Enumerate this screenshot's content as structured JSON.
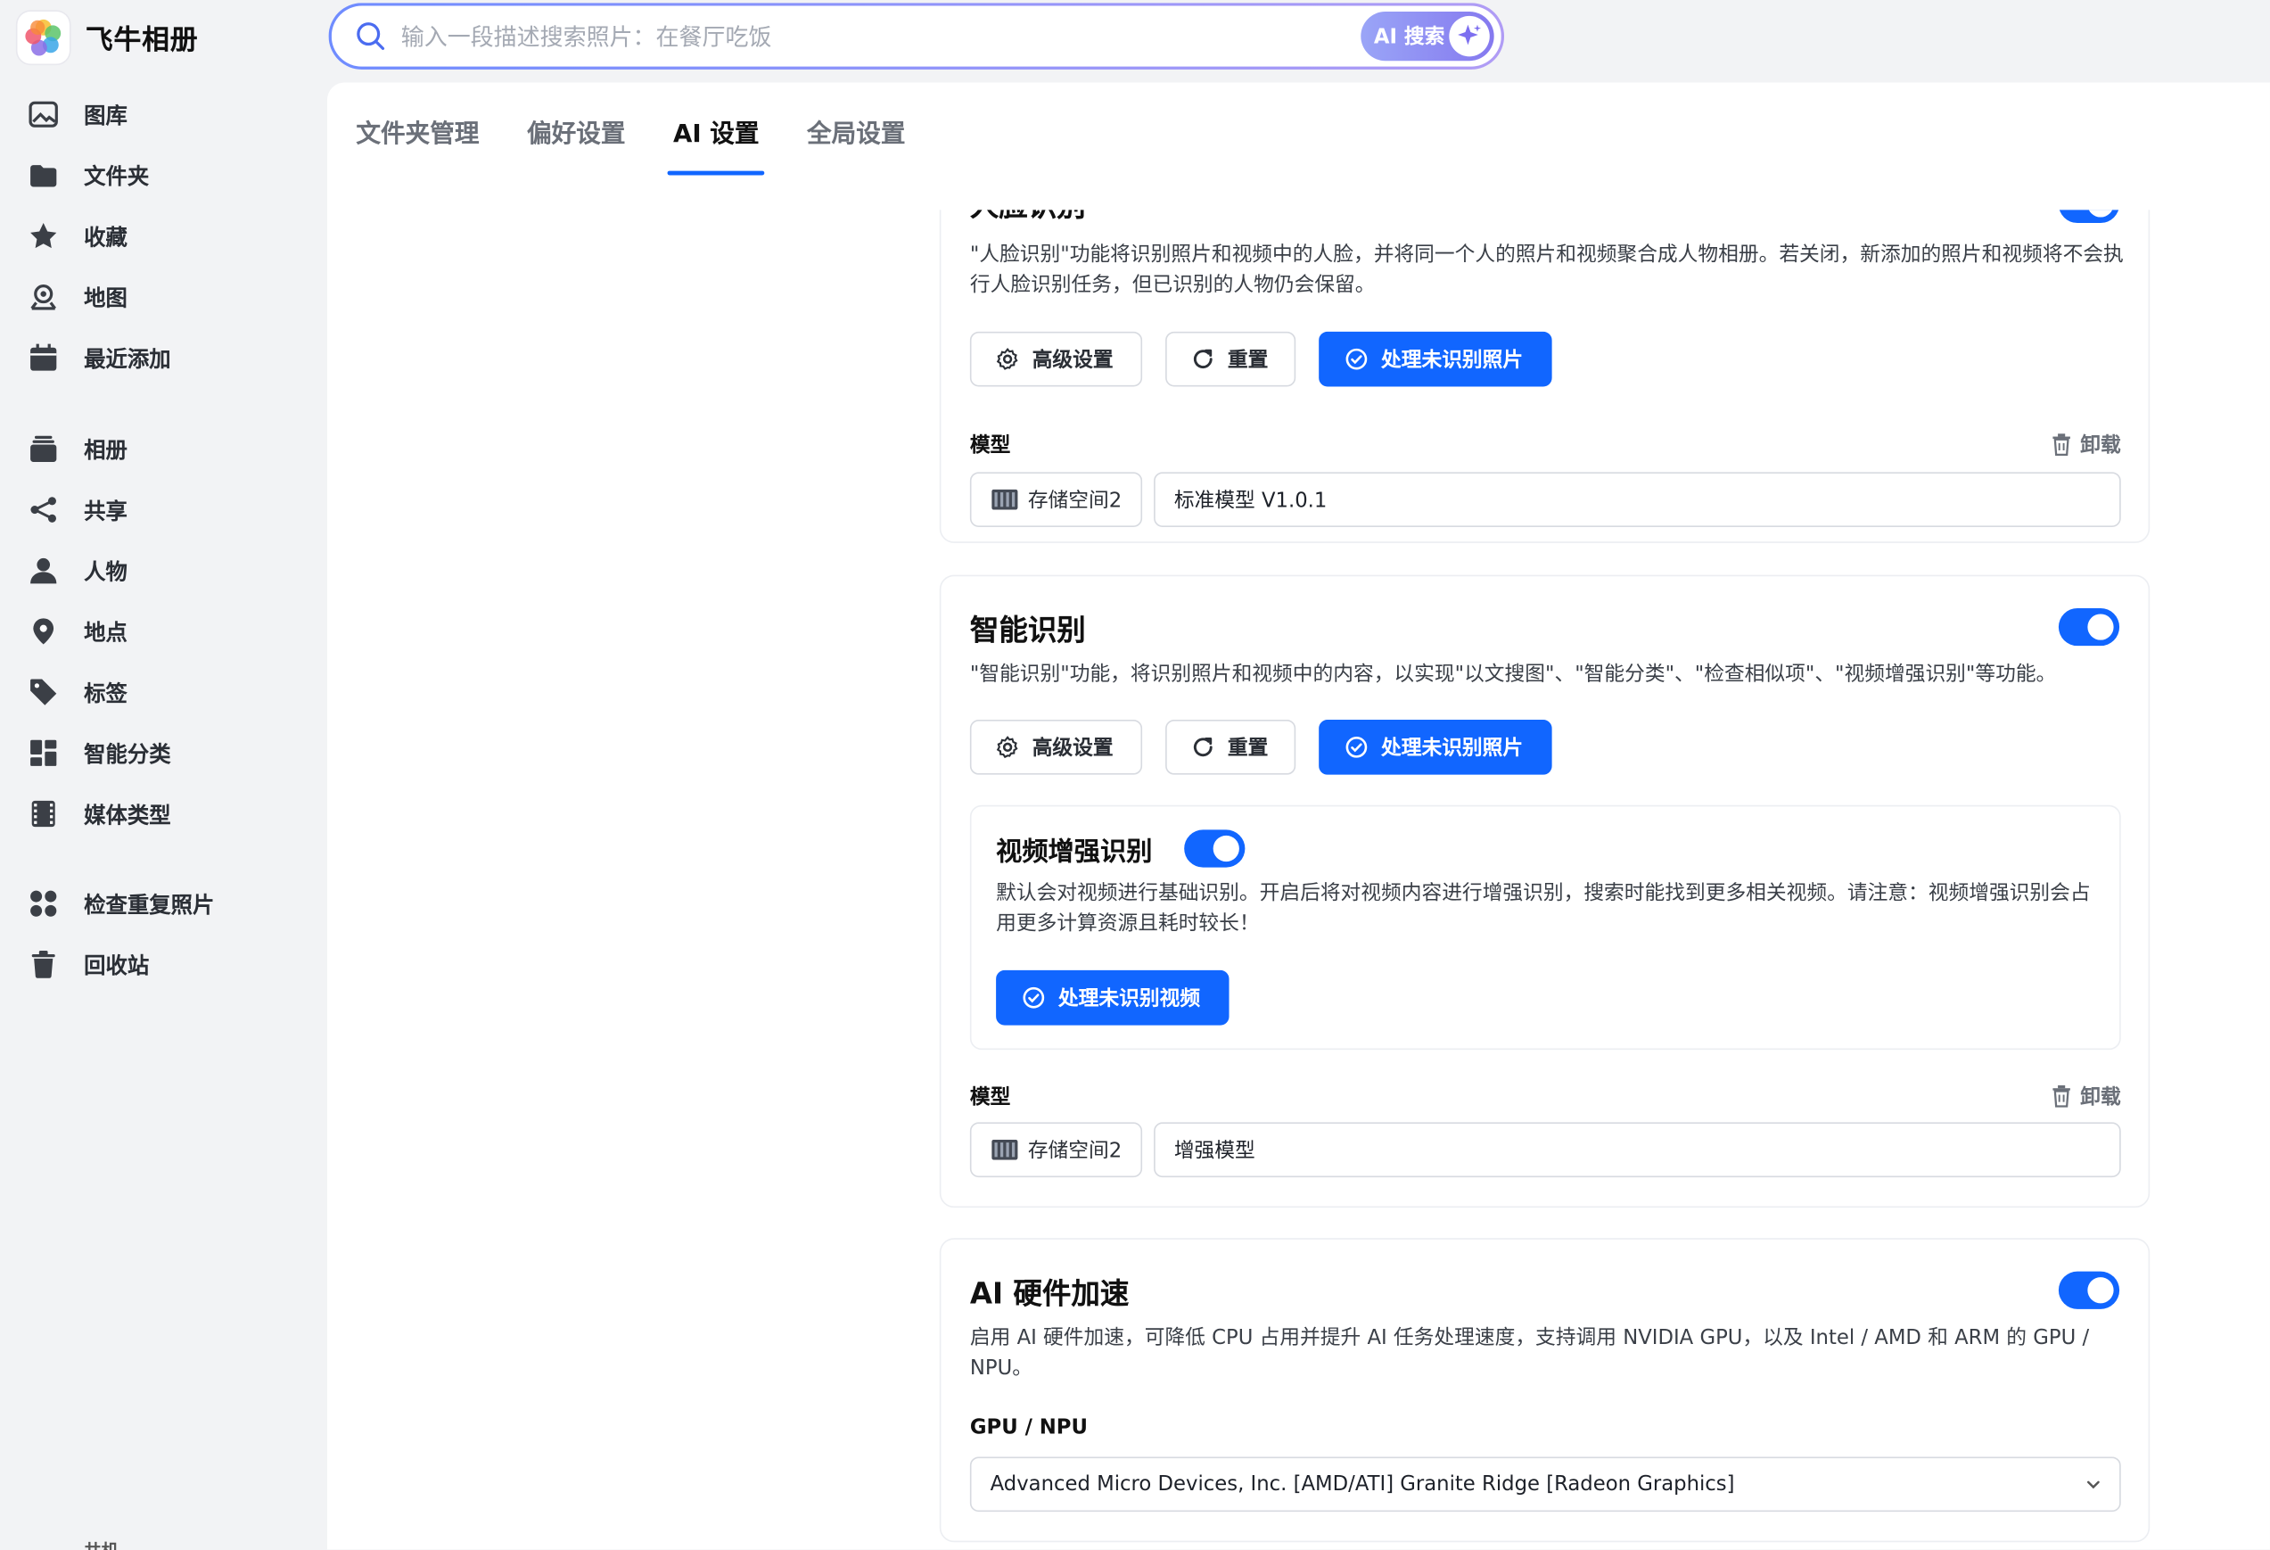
{
  "app": {
    "name": "飞牛相册"
  },
  "search": {
    "placeholder": "输入一段描述搜索照片：在餐厅吃饭",
    "ai_button": "AI 搜索"
  },
  "sidebar": {
    "items": [
      {
        "label": "图库",
        "icon": "gallery-icon"
      },
      {
        "label": "文件夹",
        "icon": "folder-icon"
      },
      {
        "label": "收藏",
        "icon": "star-icon"
      },
      {
        "label": "地图",
        "icon": "map-icon"
      },
      {
        "label": "最近添加",
        "icon": "calendar-icon"
      },
      {
        "label": "相册",
        "icon": "album-icon"
      },
      {
        "label": "共享",
        "icon": "share-icon"
      },
      {
        "label": "人物",
        "icon": "person-icon"
      },
      {
        "label": "地点",
        "icon": "location-icon"
      },
      {
        "label": "标签",
        "icon": "tag-icon"
      },
      {
        "label": "智能分类",
        "icon": "grid-icon"
      },
      {
        "label": "媒体类型",
        "icon": "film-icon"
      },
      {
        "label": "检查重复照片",
        "icon": "duplicate-icon"
      },
      {
        "label": "回收站",
        "icon": "trash-icon"
      }
    ],
    "cut_off_label": "共机"
  },
  "tabs": [
    {
      "label": "文件夹管理",
      "active": false
    },
    {
      "label": "偏好设置",
      "active": false
    },
    {
      "label": "AI 设置",
      "active": true
    },
    {
      "label": "全局设置",
      "active": false
    }
  ],
  "face_card": {
    "title": "人脸识别",
    "toggle_on": true,
    "description": "\"人脸识别\"功能将识别照片和视频中的人脸，并将同一个人的照片和视频聚合成人物相册。若关闭，新添加的照片和视频将不会执行人脸识别任务，但已识别的人物仍会保留。",
    "buttons": {
      "advanced": "高级设置",
      "reset": "重置",
      "process": "处理未识别照片"
    },
    "model_label": "模型",
    "uninstall": "卸载",
    "storage": "存储空间2",
    "model_value": "标准模型 V1.0.1"
  },
  "smart_card": {
    "title": "智能识别",
    "toggle_on": true,
    "description": "\"智能识别\"功能，将识别照片和视频中的内容，以实现\"以文搜图\"、\"智能分类\"、\"检查相似项\"、\"视频增强识别\"等功能。",
    "buttons": {
      "advanced": "高级设置",
      "reset": "重置",
      "process": "处理未识别照片"
    },
    "video": {
      "title": "视频增强识别",
      "toggle_on": true,
      "description": "默认会对视频进行基础识别。开启后将对视频内容进行增强识别，搜索时能找到更多相关视频。请注意：视频增强识别会占用更多计算资源且耗时较长！",
      "button": "处理未识别视频"
    },
    "model_label": "模型",
    "uninstall": "卸载",
    "storage": "存储空间2",
    "model_value": "增强模型"
  },
  "hw_card": {
    "title": "AI 硬件加速",
    "toggle_on": true,
    "description": "启用 AI 硬件加速，可降低 CPU 占用并提升 AI 任务处理速度，支持调用 NVIDIA GPU，以及 Intel / AMD 和 ARM 的 GPU / NPU。",
    "gpu_label": "GPU / NPU",
    "gpu_value": "Advanced Micro Devices, Inc. [AMD/ATI] Granite Ridge [Radeon Graphics]"
  },
  "colors": {
    "accent": "#1166ff",
    "background": "#f2f3f5",
    "ai_gradient_start": "#9aa5f7",
    "ai_gradient_end": "#8579ef"
  }
}
